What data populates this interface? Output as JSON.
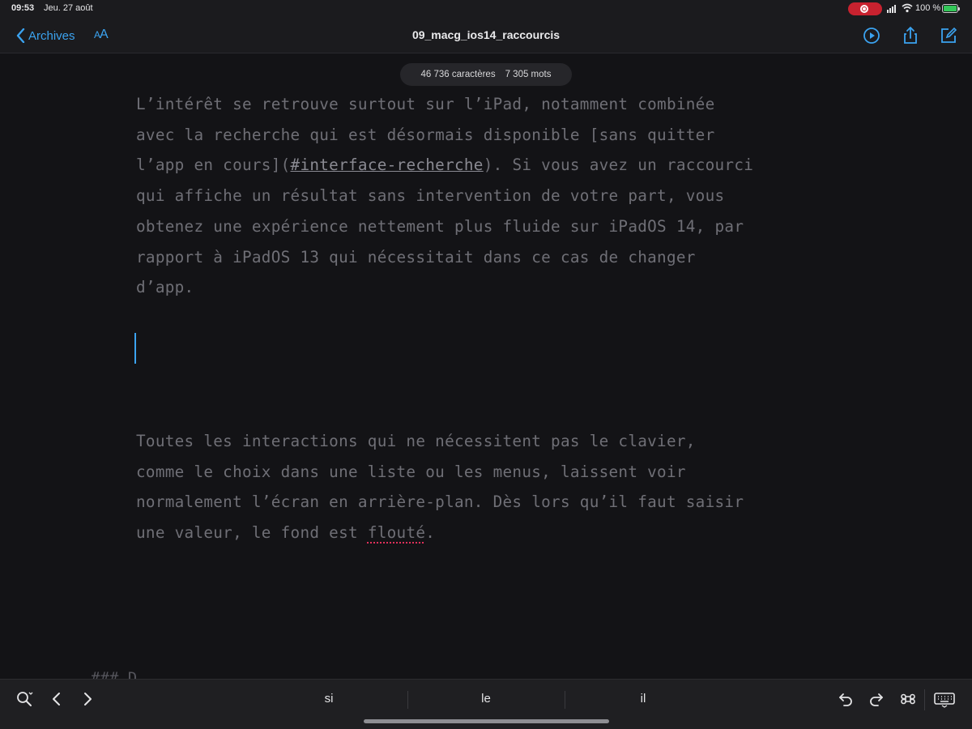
{
  "status_bar": {
    "time": "09:53",
    "date": "Jeu. 27 août",
    "battery": "100 %"
  },
  "nav": {
    "back_label": "Archives",
    "font_button_small": "A",
    "font_button_large": "A",
    "title": "09_macg_ios14_raccourcis"
  },
  "counter": {
    "characters": "46 736 caractères",
    "words": "7 305 mots"
  },
  "editor": {
    "p1_line1": "L’intérêt se retrouve surtout sur l’iPad, notamment combinée",
    "p1_line2": "avec la recherche qui est désormais disponible [sans quitter",
    "p1_line3_pre": "l’app en cours](",
    "p1_line3_link": "#interface-recherche",
    "p1_line3_post": "). Si vous avez un raccourci",
    "p1_line4": "qui affiche un résultat sans intervention de votre part, vous",
    "p1_line5": "obtenez une expérience nettement plus fluide sur iPadOS 14, par",
    "p1_line6": "rapport à iPadOS 13 qui nécessitait dans ce cas de changer",
    "p1_line7": "d’app.",
    "p2_line1": "Toutes les interactions qui ne nécessitent pas le clavier,",
    "p2_line2": "comme le choix dans une liste ou les menus, laissent voir",
    "p2_line3": "normalement l’écran en arrière-plan. Dès lors qu’il faut saisir",
    "p2_line4_pre": "une valeur, le fond est ",
    "p2_line4_err": "flouté",
    "p2_line4_post": ".",
    "heading_peek": "### D"
  },
  "shortcut_bar": {
    "suggestions": [
      "si",
      "le",
      "il"
    ]
  },
  "colors": {
    "accent": "#3ba3f0",
    "background": "#131316",
    "text": "#6f6f76",
    "spell_error": "#e0315a"
  }
}
